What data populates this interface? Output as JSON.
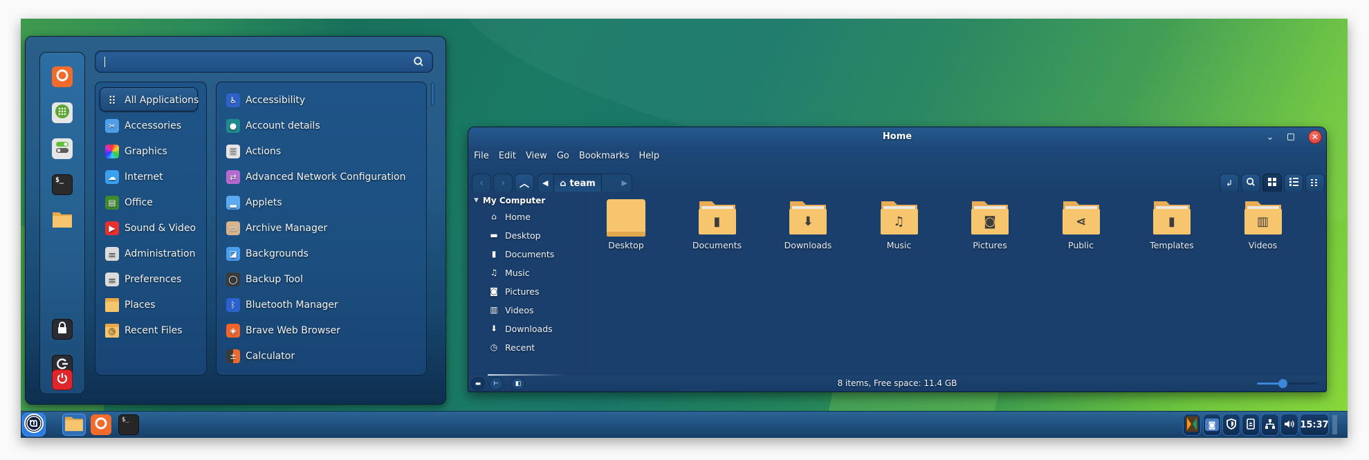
{
  "menu": {
    "search": {
      "value": "",
      "placeholder": ""
    },
    "favorites": [
      {
        "name": "firefox",
        "icon": "firefox-icon",
        "color": "#f36b2b"
      },
      {
        "name": "software-manager",
        "icon": "grid-icon",
        "color": "#e8e8e8"
      },
      {
        "name": "system-settings",
        "icon": "toggles-icon",
        "color": "#e8e8e8"
      },
      {
        "name": "terminal",
        "icon": "terminal-icon",
        "color": "#2b2b2b"
      },
      {
        "name": "files",
        "icon": "folder-icon",
        "color": "#f5c26b"
      }
    ],
    "session": [
      {
        "name": "lock-screen",
        "icon": "lock-icon",
        "color": "#2b2b33"
      },
      {
        "name": "logout",
        "icon": "logout-icon",
        "color": "#2b2b33"
      },
      {
        "name": "quit",
        "icon": "power-icon",
        "color": "#e0262a"
      }
    ],
    "categories": [
      {
        "label": "All Applications",
        "icon": "grid-dots-icon",
        "color": "transparent",
        "active": true
      },
      {
        "label": "Accessories",
        "icon": "scissors-icon",
        "color": "#4f9ee8"
      },
      {
        "label": "Graphics",
        "icon": "palette-icon",
        "color": "#c040c8"
      },
      {
        "label": "Internet",
        "icon": "cloud-icon",
        "color": "#3aa0f0"
      },
      {
        "label": "Office",
        "icon": "office-icon",
        "color": "#3e8a2c"
      },
      {
        "label": "Sound & Video",
        "icon": "play-icon",
        "color": "#e8302e"
      },
      {
        "label": "Administration",
        "icon": "admin-icon",
        "color": "#dcdcdc"
      },
      {
        "label": "Preferences",
        "icon": "preferences-icon",
        "color": "#dcdcdc"
      },
      {
        "label": "Places",
        "icon": "folder-icon",
        "color": "#f5c26b"
      },
      {
        "label": "Recent Files",
        "icon": "recent-folder-icon",
        "color": "#f5c26b"
      }
    ],
    "apps": [
      {
        "label": "Accessibility",
        "icon": "accessibility-icon",
        "color": "#2f62c8"
      },
      {
        "label": "Account details",
        "icon": "user-icon",
        "color": "#1f8a8e"
      },
      {
        "label": "Actions",
        "icon": "list-icon",
        "color": "#e6e6e6"
      },
      {
        "label": "Advanced Network Configuration",
        "icon": "network-arrows-icon",
        "color": "#b46ad0"
      },
      {
        "label": "Applets",
        "icon": "applets-icon",
        "color": "#5aaaf0"
      },
      {
        "label": "Archive Manager",
        "icon": "archive-icon",
        "color": "#d8b48c"
      },
      {
        "label": "Backgrounds",
        "icon": "backgrounds-icon",
        "color": "#4a9ef0"
      },
      {
        "label": "Backup Tool",
        "icon": "backup-icon",
        "color": "#3a3a3a"
      },
      {
        "label": "Bluetooth Manager",
        "icon": "bluetooth-icon",
        "color": "#2a62d0"
      },
      {
        "label": "Brave Web Browser",
        "icon": "brave-icon",
        "color": "#f0642a"
      },
      {
        "label": "Calculator",
        "icon": "calculator-icon",
        "color": "#3a3a3a"
      }
    ]
  },
  "file_manager": {
    "title": "Home",
    "menubar": [
      "File",
      "Edit",
      "View",
      "Go",
      "Bookmarks",
      "Help"
    ],
    "breadcrumb": {
      "current": "team"
    },
    "sidebar": {
      "section": "My Computer",
      "items": [
        {
          "label": "Home",
          "icon": "home-icon",
          "glyph": "⌂"
        },
        {
          "label": "Desktop",
          "icon": "desktop-icon",
          "glyph": "▬"
        },
        {
          "label": "Documents",
          "icon": "document-icon",
          "glyph": "▮"
        },
        {
          "label": "Music",
          "icon": "music-icon",
          "glyph": "♫"
        },
        {
          "label": "Pictures",
          "icon": "camera-icon",
          "glyph": "◙"
        },
        {
          "label": "Videos",
          "icon": "film-icon",
          "glyph": "▥"
        },
        {
          "label": "Downloads",
          "icon": "download-icon",
          "glyph": "⬇"
        },
        {
          "label": "Recent",
          "icon": "clock-icon",
          "glyph": "◷"
        }
      ]
    },
    "folders": [
      {
        "label": "Desktop",
        "icon": "desktop-folder-icon",
        "emblem": ""
      },
      {
        "label": "Documents",
        "icon": "documents-folder-icon",
        "emblem": "▮"
      },
      {
        "label": "Downloads",
        "icon": "downloads-folder-icon",
        "emblem": "⬇"
      },
      {
        "label": "Music",
        "icon": "music-folder-icon",
        "emblem": "♫"
      },
      {
        "label": "Pictures",
        "icon": "pictures-folder-icon",
        "emblem": "◙"
      },
      {
        "label": "Public",
        "icon": "public-folder-icon",
        "emblem": "⋖"
      },
      {
        "label": "Templates",
        "icon": "templates-folder-icon",
        "emblem": "▮"
      },
      {
        "label": "Videos",
        "icon": "videos-folder-icon",
        "emblem": "▥"
      }
    ],
    "status": "8 items, Free space: 11.4 GB",
    "zoom_level": 0.42
  },
  "taskbar": {
    "launchers": [
      {
        "name": "files",
        "icon": "folder-icon"
      },
      {
        "name": "firefox",
        "icon": "firefox-icon"
      },
      {
        "name": "terminal",
        "icon": "terminal-icon"
      }
    ],
    "tray": [
      {
        "name": "xapp-status",
        "icon": "xapp-icon"
      },
      {
        "name": "screenshot",
        "icon": "camera-icon"
      },
      {
        "name": "security",
        "icon": "shield-icon"
      },
      {
        "name": "removable-drives",
        "icon": "eject-icon"
      },
      {
        "name": "network",
        "icon": "network-icon"
      },
      {
        "name": "sound",
        "icon": "volume-icon"
      }
    ],
    "clock": "15:37"
  }
}
